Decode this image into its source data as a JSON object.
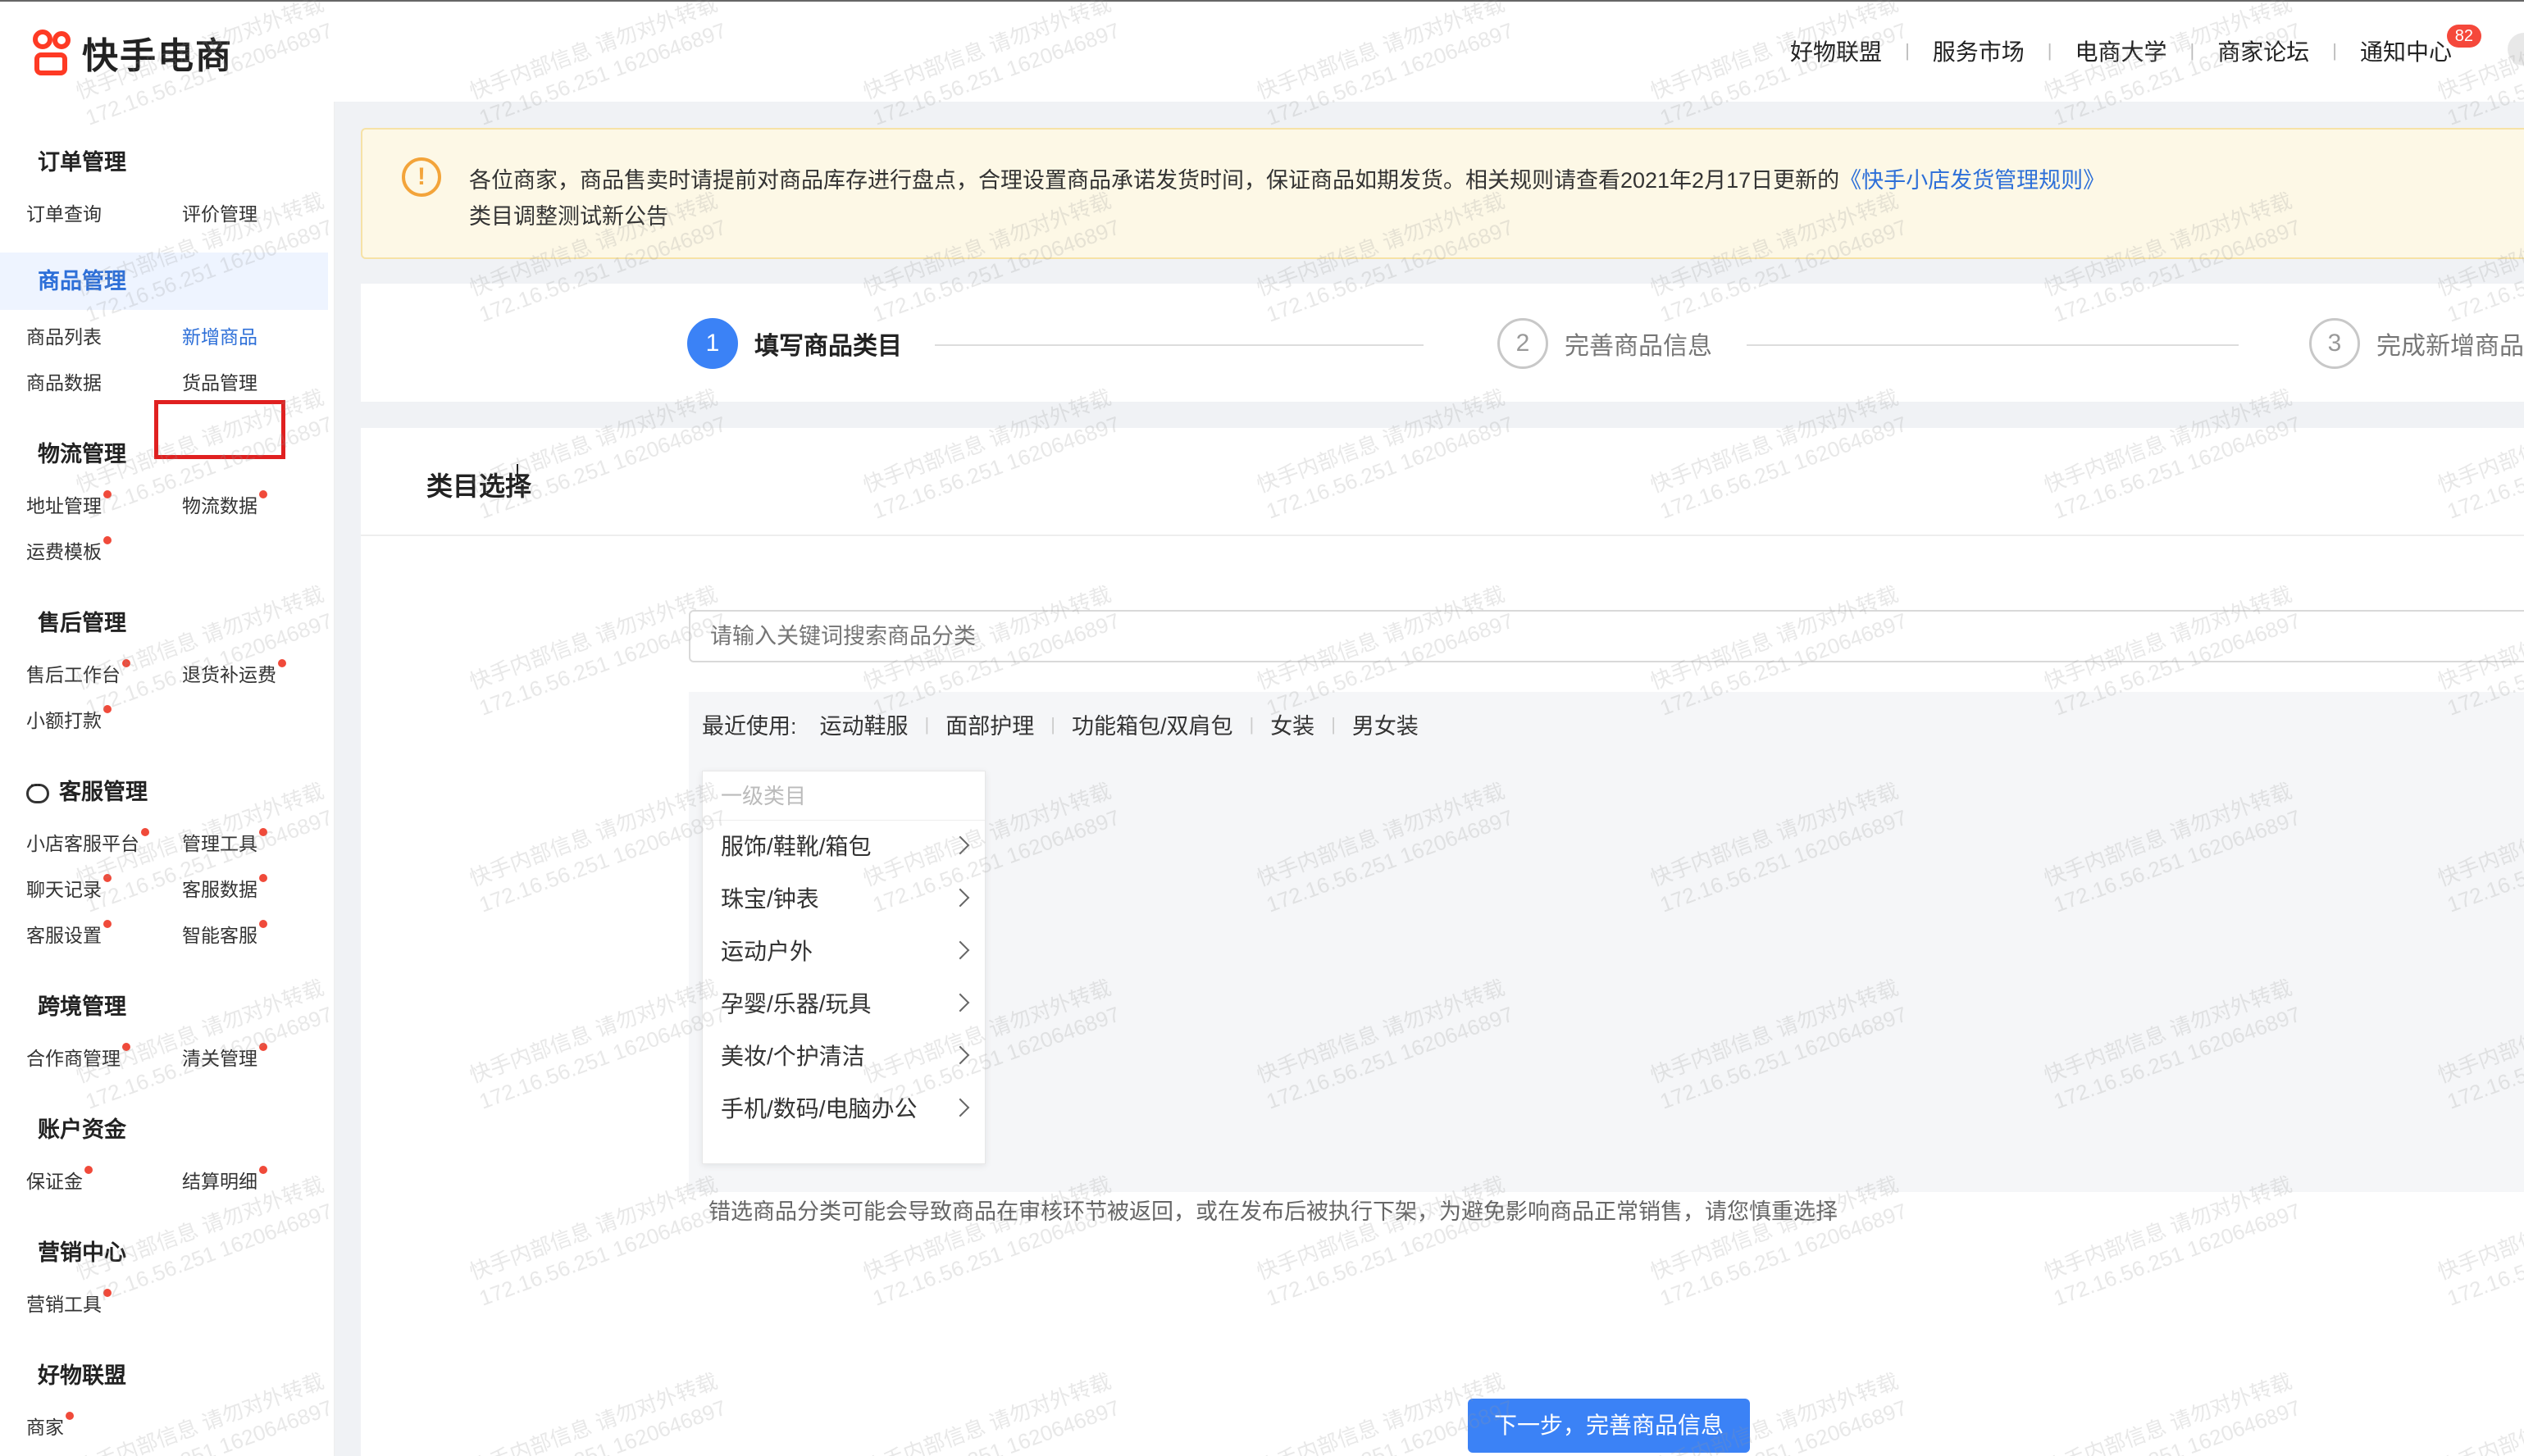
{
  "app": {
    "logo_text": "快手电商",
    "accent": "#3b82f6",
    "brand": "#fe3a24"
  },
  "topnav": {
    "items": [
      "好物联盟",
      "服务市场",
      "电商大学",
      "商家论坛",
      "通知中心"
    ],
    "notification_badge": "82"
  },
  "sidebar": {
    "groups": [
      {
        "title": "订单管理",
        "links": [
          "订单查询",
          "评价管理"
        ]
      },
      {
        "title": "商品管理",
        "links": [
          "商品列表",
          "新增商品",
          "商品数据",
          "货品管理"
        ]
      },
      {
        "title": "物流管理",
        "links": [
          "地址管理",
          "物流数据",
          "运费模板"
        ]
      },
      {
        "title": "售后管理",
        "links": [
          "售后工作台",
          "退货补运费",
          "小额打款"
        ]
      },
      {
        "title": "客服管理",
        "links": [
          "小店客服平台",
          "管理工具",
          "聊天记录",
          "客服数据",
          "客服设置",
          "智能客服"
        ]
      },
      {
        "title": "跨境管理",
        "links": [
          "合作商管理",
          "清关管理"
        ]
      },
      {
        "title": "账户资金",
        "links": [
          "保证金",
          "结算明细"
        ]
      },
      {
        "title": "营销中心",
        "links": [
          "营销工具"
        ]
      },
      {
        "title": "好物联盟",
        "links": [
          "商家"
        ]
      }
    ]
  },
  "notice": {
    "line1_text": "各位商家，商品售卖时请提前对商品库存进行盘点，合理设置商品承诺发货时间，保证商品如期发货。相关规则请查看2021年2月17日更新的",
    "line1_link": "《快手小店发货管理规则》",
    "line2": "类目调整测试新公告"
  },
  "steps": [
    {
      "num": "1",
      "label": "填写商品类目"
    },
    {
      "num": "2",
      "label": "完善商品信息"
    },
    {
      "num": "3",
      "label": "完成新增商品"
    }
  ],
  "main": {
    "section_title": "类目选择",
    "search_placeholder": "请输入关键词搜索商品分类",
    "recent_label": "最近使用:",
    "recent_tags": [
      "运动鞋服",
      "面部护理",
      "功能箱包/双肩包",
      "女装",
      "男女装"
    ],
    "category_header": "一级类目",
    "categories": [
      "服饰/鞋靴/箱包",
      "珠宝/钟表",
      "运动户外",
      "孕婴/乐器/玩具",
      "美妆/个护清洁",
      "手机/数码/电脑办公"
    ],
    "warning": "错选商品分类可能会导致商品在审核环节被返回，或在发布后被执行下架，为避免影响商品正常销售，请您慎重选择",
    "next_button": "下一步，完善商品信息"
  },
  "watermark": {
    "line1": "快手内部信息 请勿对外转载",
    "line2": "172.16.56.251 1620646897"
  }
}
